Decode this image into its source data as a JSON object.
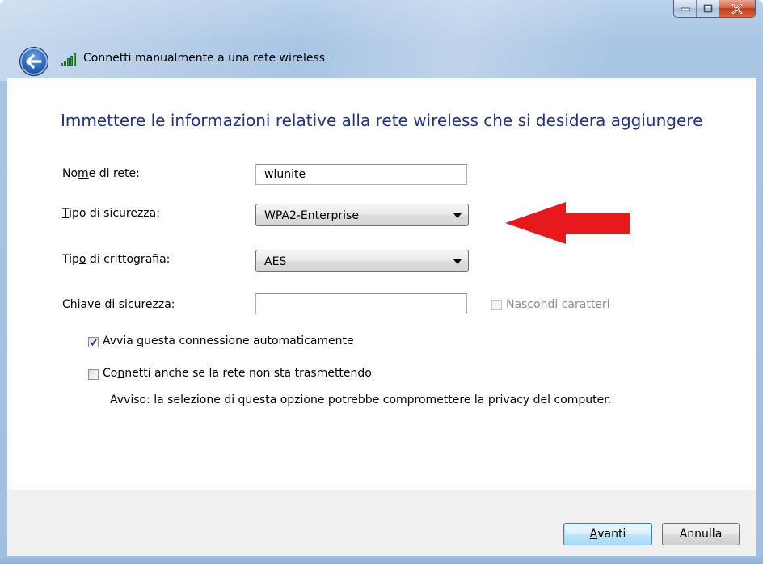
{
  "window": {
    "title": "Connetti manualmente a una rete wireless",
    "controls": {
      "minimize": "minimize-icon",
      "maximize": "maximize-icon",
      "close": "close-icon"
    }
  },
  "content": {
    "heading": "Immettere le informazioni relative alla rete wireless che si desidera aggiungere",
    "network_name": {
      "label_a": "No",
      "label_u": "m",
      "label_b": "e di rete:",
      "value": "wlunite"
    },
    "security_type": {
      "label_a": "",
      "label_u": "T",
      "label_b": "ipo di sicurezza:",
      "value": "WPA2-Enterprise"
    },
    "encryption_type": {
      "label_a": "Tip",
      "label_u": "o",
      "label_b": " di crittografia:",
      "value": "AES"
    },
    "security_key": {
      "label_a": "",
      "label_u": "C",
      "label_b": "hiave di sicurezza:",
      "value": ""
    },
    "hide_characters": {
      "label_a": "Nascon",
      "label_u": "d",
      "label_b": "i caratteri",
      "checked": false,
      "enabled": false
    },
    "auto_connect": {
      "label_a": "Avvia ",
      "label_u": "q",
      "label_b": "uesta connessione automaticamente",
      "checked": true
    },
    "connect_hidden": {
      "label_a": "Co",
      "label_u": "n",
      "label_b": "netti anche se la rete non sta trasmettendo",
      "checked": false
    },
    "warning": "Avviso: la selezione di questa opzione potrebbe compromettere la privacy del computer."
  },
  "footer": {
    "next": {
      "label_a": "",
      "label_u": "A",
      "label_b": "vanti"
    },
    "cancel": "Annulla"
  },
  "annotation": {
    "color": "#e8191d",
    "type": "arrow-left"
  }
}
